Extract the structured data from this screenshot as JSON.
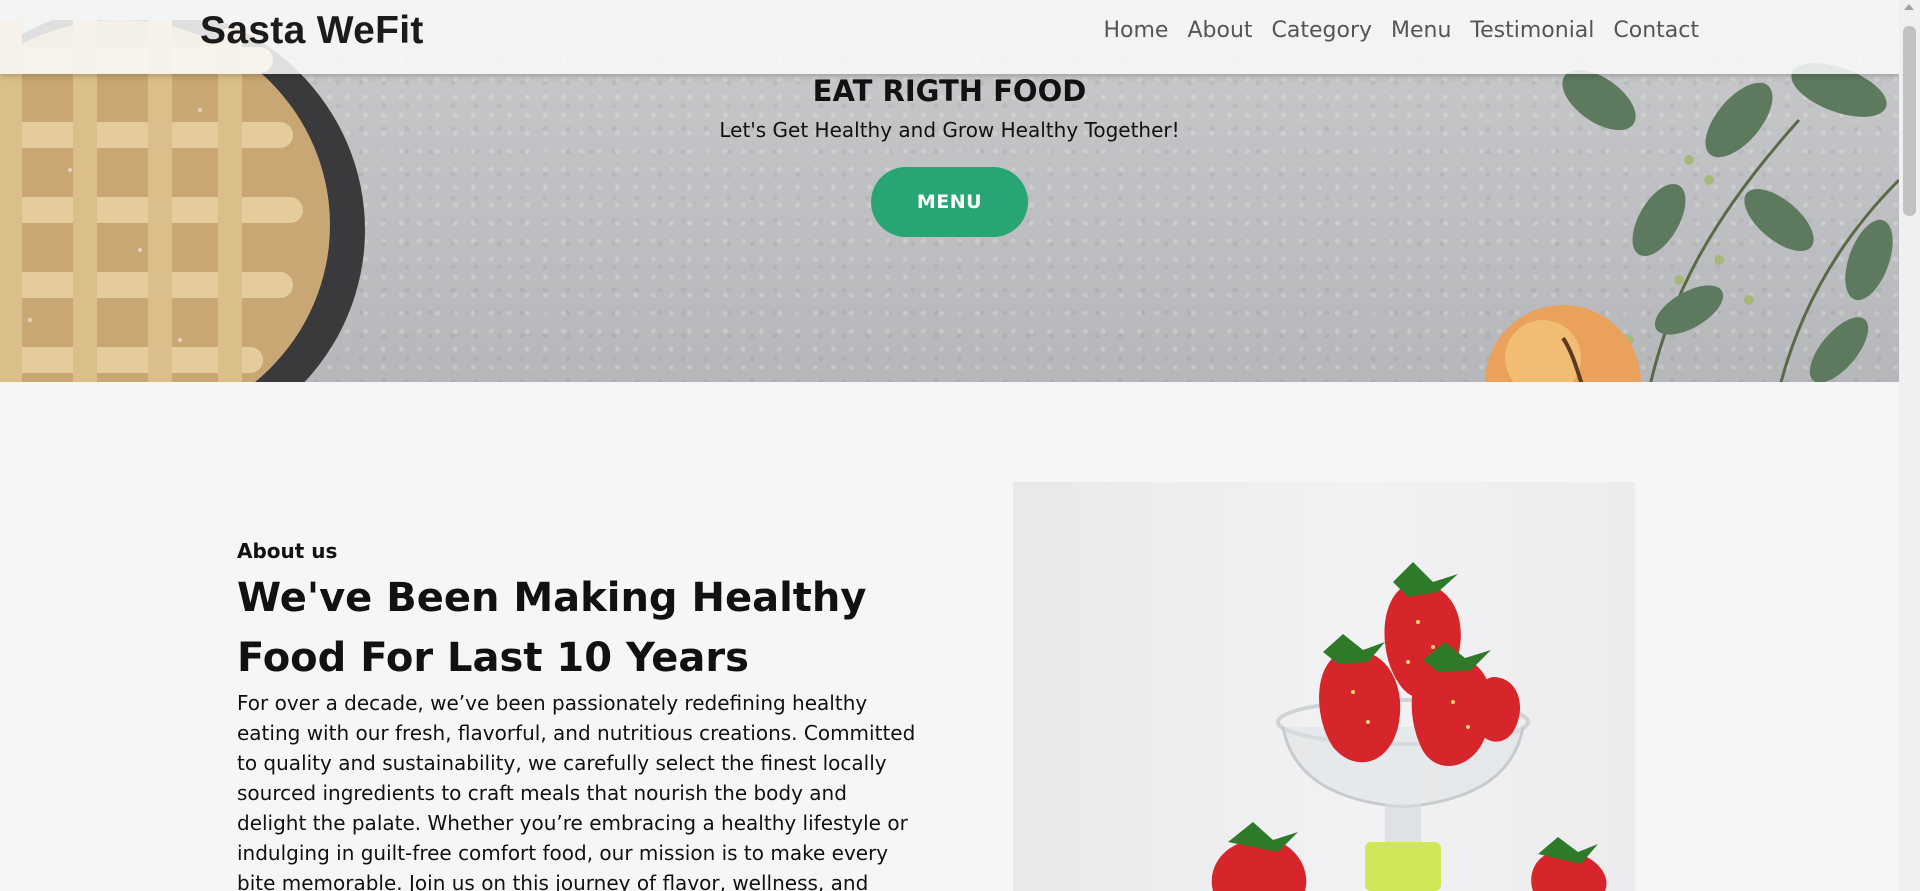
{
  "brand": "Sasta WeFit",
  "nav": [
    "Home",
    "About",
    "Category",
    "Menu",
    "Testimonial",
    "Contact"
  ],
  "hero": {
    "title": "EAT RIGTH FOOD",
    "subtitle": "Let's Get Healthy and Grow Healthy Together!",
    "button_label": "MENU"
  },
  "about": {
    "label": "About us",
    "title": "We've Been Making Healthy Food For Last 10 Years",
    "text": "For over a decade, we’ve been passionately redefining healthy eating with our fresh, flavorful, and nutritious creations. Committed to quality and sustainability, we carefully select the finest locally sourced ingredients to craft meals that nourish the body and delight the palate. Whether you’re embracing a healthy lifestyle or indulging in guilt-free comfort food, our mission is to make every bite memorable. Join us on this journey of flavor, wellness, and"
  },
  "colors": {
    "accent": "#27a673",
    "background": "#f6f6f8",
    "brand_text": "#1d1b19",
    "nav_text": "#555555"
  }
}
